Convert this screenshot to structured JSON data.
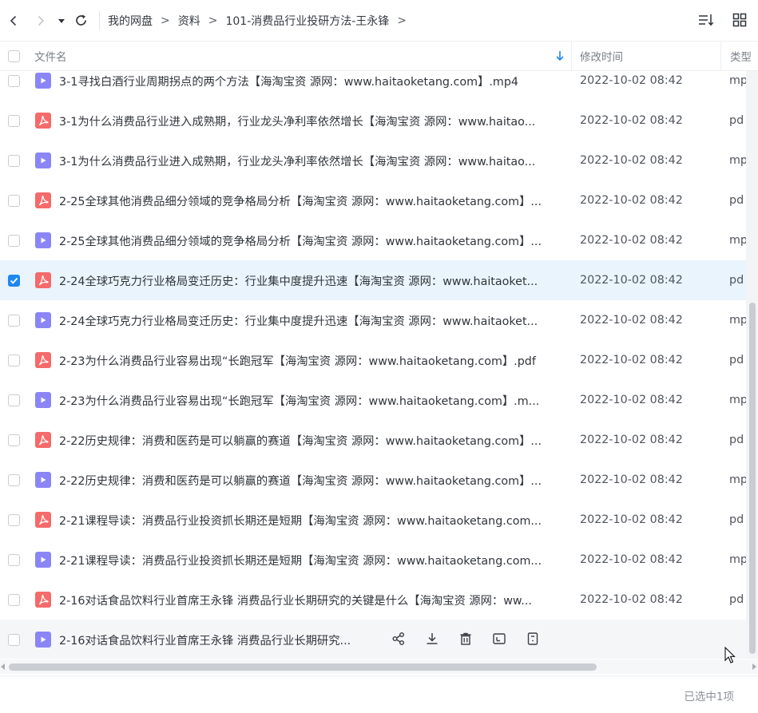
{
  "toolbar": {
    "breadcrumb": [
      "我的网盘",
      "资料",
      "101-消费品行业投研方法-王永锋"
    ],
    "separator": ">"
  },
  "header": {
    "name_label": "文件名",
    "time_label": "修改时间",
    "type_label": "类型"
  },
  "rows": [
    {
      "icon": "video-file-icon",
      "name": "3-1寻找白酒行业周期拐点的两个方法【海淘宝资 源网：www.haitaoketang.com】.mp4",
      "time": "2022-10-02 08:42",
      "type": "mp"
    },
    {
      "icon": "pdf-file-icon",
      "name": "3-1为什么消费品行业进入成熟期，行业龙头净利率依然增长【海淘宝资 源网：www.haitao...",
      "time": "2022-10-02 08:42",
      "type": "pd"
    },
    {
      "icon": "video-file-icon",
      "name": "3-1为什么消费品行业进入成熟期，行业龙头净利率依然增长【海淘宝资 源网：www.haitao...",
      "time": "2022-10-02 08:42",
      "type": "mp"
    },
    {
      "icon": "pdf-file-icon",
      "name": "2-25全球其他消费品细分领域的竞争格局分析【海淘宝资 源网：www.haitaoketang.com】...",
      "time": "2022-10-02 08:42",
      "type": "pd"
    },
    {
      "icon": "video-file-icon",
      "name": "2-25全球其他消费品细分领域的竞争格局分析【海淘宝资 源网：www.haitaoketang.com】...",
      "time": "2022-10-02 08:42",
      "type": "mp"
    },
    {
      "icon": "pdf-file-icon",
      "name": "2-24全球巧克力行业格局变迁历史：行业集中度提升迅速【海淘宝资 源网：www.haitaoket...",
      "time": "2022-10-02 08:42",
      "type": "pd",
      "selected": true
    },
    {
      "icon": "video-file-icon",
      "name": "2-24全球巧克力行业格局变迁历史：行业集中度提升迅速【海淘宝资 源网：www.haitaoket...",
      "time": "2022-10-02 08:42",
      "type": "mp"
    },
    {
      "icon": "pdf-file-icon",
      "name": "2-23为什么消费品行业容易出现“长跑冠军【海淘宝资 源网：www.haitaoketang.com】.pdf",
      "time": "2022-10-02 08:42",
      "type": "pd"
    },
    {
      "icon": "video-file-icon",
      "name": "2-23为什么消费品行业容易出现“长跑冠军【海淘宝资 源网：www.haitaoketang.com】.m...",
      "time": "2022-10-02 08:42",
      "type": "mp"
    },
    {
      "icon": "pdf-file-icon",
      "name": "2-22历史规律：消费和医药是可以躺赢的赛道【海淘宝资 源网：www.haitaoketang.com】...",
      "time": "2022-10-02 08:42",
      "type": "pd"
    },
    {
      "icon": "video-file-icon",
      "name": "2-22历史规律：消费和医药是可以躺赢的赛道【海淘宝资 源网：www.haitaoketang.com】...",
      "time": "2022-10-02 08:42",
      "type": "mp"
    },
    {
      "icon": "pdf-file-icon",
      "name": "2-21课程导读：消费品行业投资抓长期还是短期【海淘宝资 源网：www.haitaoketang.com...",
      "time": "2022-10-02 08:42",
      "type": "pd"
    },
    {
      "icon": "video-file-icon",
      "name": "2-21课程导读：消费品行业投资抓长期还是短期【海淘宝资 源网：www.haitaoketang.com...",
      "time": "2022-10-02 08:42",
      "type": "mp"
    },
    {
      "icon": "pdf-file-icon",
      "name": "2-16对话食品饮料行业首席王永锋 消费品行业长期研究的关键是什么【海淘宝资 源网：ww...",
      "time": "2022-10-02 08:42",
      "type": "pd"
    },
    {
      "icon": "video-file-icon",
      "name": "2-16对话食品饮料行业首席王永锋 消费品行业长期研究...",
      "time": "",
      "type": "",
      "hovered": true
    }
  ],
  "footer": {
    "status": "已选中1项"
  },
  "colors": {
    "accent": "#1f87f0",
    "selected_row": "#e9f4fd",
    "video_icon": "#8a86f8",
    "pdf_icon": "#f56a6a"
  }
}
